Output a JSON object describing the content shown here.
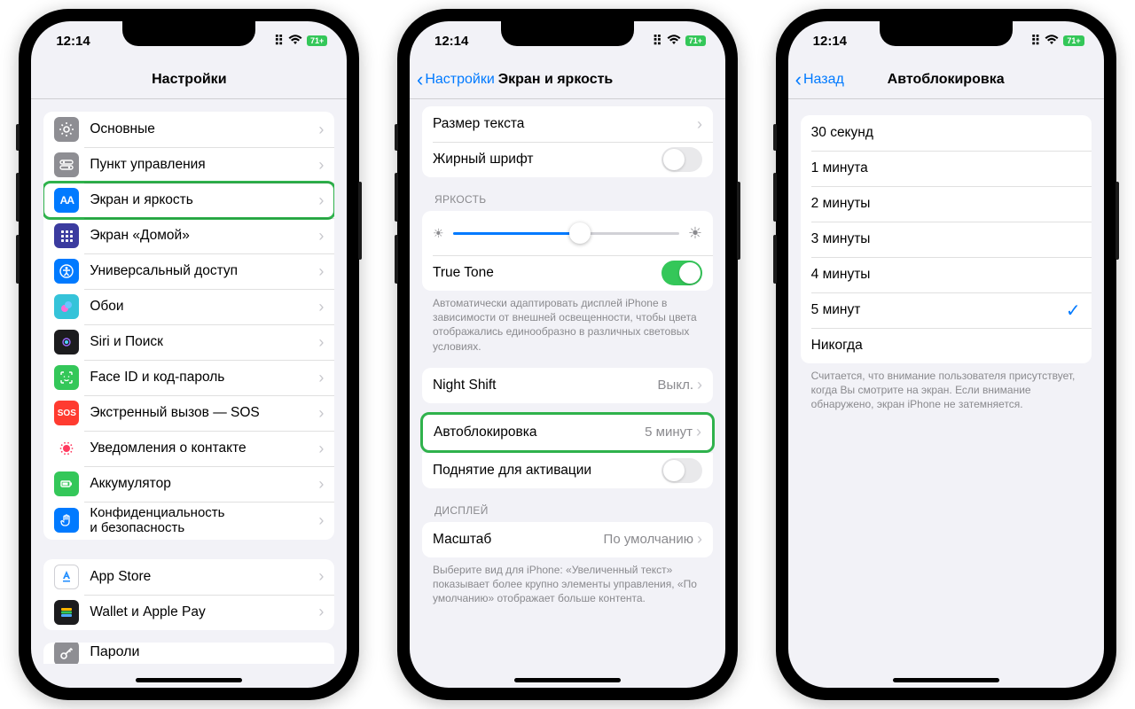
{
  "status": {
    "time": "12:14",
    "battery": "71+"
  },
  "phone1": {
    "title": "Настройки",
    "group1": [
      {
        "icon": "gear",
        "bg": "#8e8e93",
        "label": "Основные"
      },
      {
        "icon": "ctrl",
        "bg": "#8e8e93",
        "label": "Пункт управления"
      },
      {
        "icon": "AA",
        "bg": "#007aff",
        "label": "Экран и яркость",
        "hl": true
      },
      {
        "icon": "grid",
        "bg": "#3b3b9f",
        "label": "Экран «Домой»"
      },
      {
        "icon": "acc",
        "bg": "#007aff",
        "label": "Универсальный доступ"
      },
      {
        "icon": "wall",
        "bg": "#35c3d9",
        "label": "Обои"
      },
      {
        "icon": "siri",
        "bg": "#1c1c1e",
        "label": "Siri и Поиск"
      },
      {
        "icon": "face",
        "bg": "#34c759",
        "label": "Face ID и код-пароль"
      },
      {
        "icon": "SOS",
        "bg": "#ff3b30",
        "label": "Экстренный вызов — SOS"
      },
      {
        "icon": "dot",
        "bg": "#ffffff",
        "label": "Уведомления о контакте",
        "fg": "#ff3b60"
      },
      {
        "icon": "batt",
        "bg": "#34c759",
        "label": "Аккумулятор"
      },
      {
        "icon": "hand",
        "bg": "#007aff",
        "label": "Конфиденциальность\nи безопасность"
      }
    ],
    "group2": [
      {
        "icon": "A",
        "bg": "#ffffff",
        "label": "App Store",
        "fg": "#1f8dff",
        "border": true
      },
      {
        "icon": "wal",
        "bg": "#1c1c1e",
        "label": "Wallet и Apple Pay"
      }
    ],
    "partial": {
      "label": "Пароли"
    }
  },
  "phone2": {
    "back": "Настройки",
    "title": "Экран и яркость",
    "textGroup": [
      {
        "label": "Размер текста",
        "chev": true
      },
      {
        "label": "Жирный шрифт",
        "toggle": false
      }
    ],
    "brightHeader": "ЯРКОСТЬ",
    "truetone": {
      "label": "True Tone",
      "on": true
    },
    "truetoneFooter": "Автоматически адаптировать дисплей iPhone в зависимости от внешней освещенности, чтобы цвета отображались единообразно в различных световых условиях.",
    "nightshift": {
      "label": "Night Shift",
      "value": "Выкл."
    },
    "autolock": {
      "label": "Автоблокировка",
      "value": "5 минут"
    },
    "raise": {
      "label": "Поднятие для активации",
      "toggle": false
    },
    "displayHeader": "ДИСПЛЕЙ",
    "zoom": {
      "label": "Масштаб",
      "value": "По умолчанию"
    },
    "zoomFooter": "Выберите вид для iPhone: «Увеличенный текст» показывает более крупно элементы управления, «По умолчанию» отображает больше контента."
  },
  "phone3": {
    "back": "Назад",
    "title": "Автоблокировка",
    "options": [
      "30 секунд",
      "1 минута",
      "2 минуты",
      "3 минуты",
      "4 минуты",
      "5 минут",
      "Никогда"
    ],
    "selected": "5 минут",
    "footer": "Считается, что внимание пользователя присутствует, когда Вы смотрите на экран. Если внимание обнаружено, экран iPhone не затемняется."
  }
}
